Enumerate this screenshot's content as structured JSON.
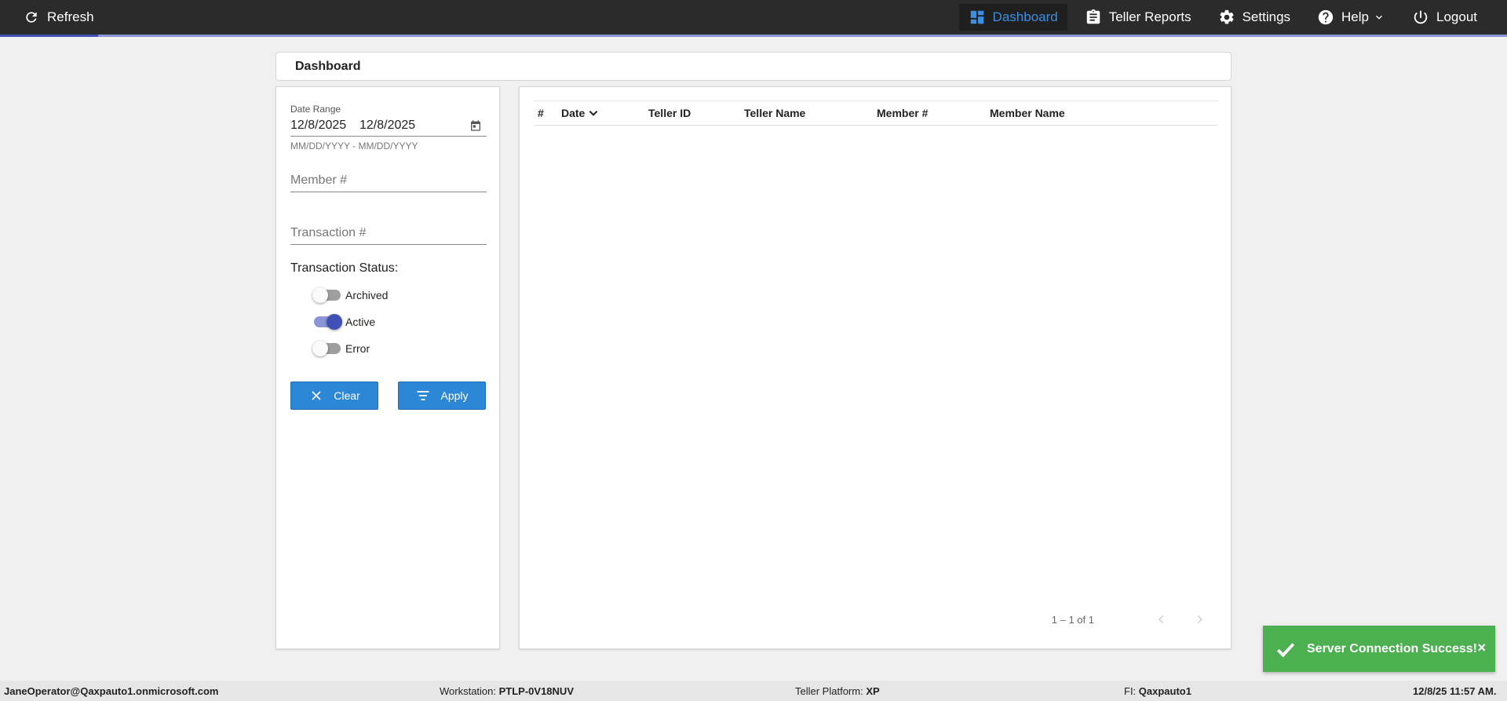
{
  "nav": {
    "refresh_label": "Refresh",
    "items": [
      {
        "label": "Dashboard",
        "icon": "dashboard-icon",
        "active": true
      },
      {
        "label": "Teller Reports",
        "icon": "clipboard-icon",
        "active": false
      },
      {
        "label": "Settings",
        "icon": "gear-icon",
        "active": false
      },
      {
        "label": "Help",
        "icon": "help-icon",
        "active": false
      },
      {
        "label": "Logout",
        "icon": "power-icon",
        "active": false
      }
    ],
    "accent_color": "#3d8ee0"
  },
  "page": {
    "title": "Dashboard"
  },
  "filters": {
    "date_range": {
      "label": "Date Range",
      "start": "12/8/2025",
      "end": "12/8/2025",
      "hint": "MM/DD/YYYY - MM/DD/YYYY"
    },
    "member_placeholder": "Member #",
    "transaction_placeholder": "Transaction #",
    "status_title": "Transaction Status:",
    "statuses": [
      {
        "label": "Archived",
        "on": false
      },
      {
        "label": "Active",
        "on": true
      },
      {
        "label": "Error",
        "on": false
      }
    ],
    "clear_label": "Clear",
    "apply_label": "Apply"
  },
  "table": {
    "columns": [
      "#",
      "Date",
      "Teller ID",
      "Teller Name",
      "Member #",
      "Member Name"
    ],
    "rows": [],
    "pagination": "1 – 1 of 1"
  },
  "toast": {
    "message": "Server Connection Success!",
    "close_label": "×",
    "color": "#4caf50"
  },
  "footer": {
    "user": "JaneOperator@Qaxpauto1.onmicrosoft.com",
    "workstation_label": "Workstation: ",
    "workstation": "PTLP-0V18NUV",
    "platform_label": "Teller Platform: ",
    "platform": "XP",
    "fi_label": "FI: ",
    "fi": "Qaxpauto1",
    "timestamp": "12/8/25 11:57 AM."
  }
}
